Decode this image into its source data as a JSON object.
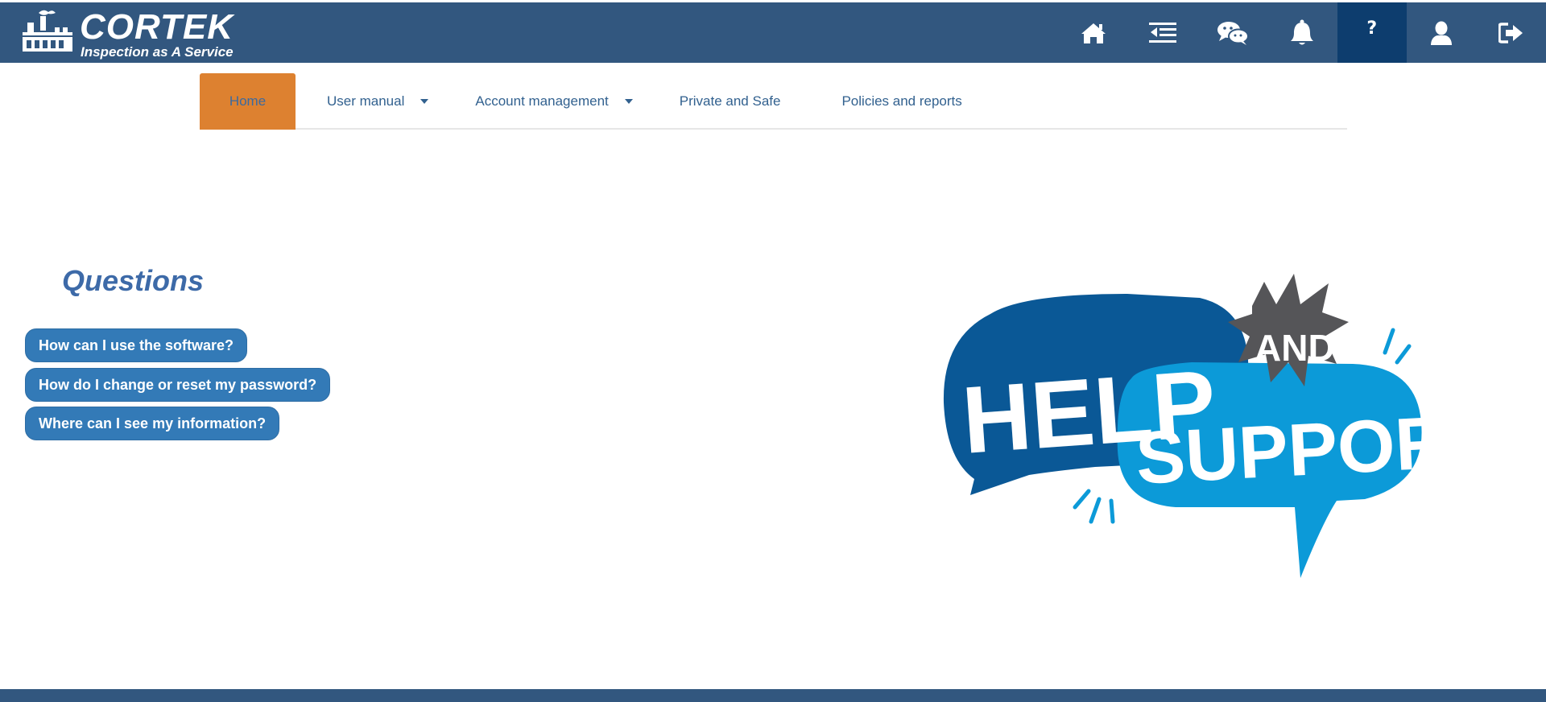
{
  "brand": {
    "name": "CORTEK",
    "tagline": "Inspection as A Service",
    "logo_icon": "factory-icon"
  },
  "header": {
    "background": "#32577f",
    "active_background": "#0d3d6e",
    "icons": [
      {
        "name": "home-icon"
      },
      {
        "name": "menu-collapse-icon"
      },
      {
        "name": "chat-icon"
      },
      {
        "name": "bell-icon"
      },
      {
        "name": "help-icon",
        "label": "?",
        "active": true
      },
      {
        "name": "user-icon"
      },
      {
        "name": "logout-icon"
      }
    ]
  },
  "tabs": {
    "accent": "#dd8130",
    "items": [
      {
        "label": "Home",
        "active": true
      },
      {
        "label": "User manual",
        "dropdown": true
      },
      {
        "label": "Account management",
        "dropdown": true
      },
      {
        "label": "Private and Safe"
      },
      {
        "label": "Policies and reports"
      }
    ]
  },
  "questions": {
    "title": "Questions",
    "button_color": "#337ab7",
    "items": [
      "How can I use the software?",
      "How do I change or reset my password?",
      "Where can I see my information?"
    ]
  },
  "illustration": {
    "word1": "HELP",
    "word2": "AND",
    "word3": "SUPPORT",
    "colors": {
      "dark_blue": "#0a5896",
      "light_blue": "#0c9ad8",
      "gray": "#555558"
    }
  }
}
